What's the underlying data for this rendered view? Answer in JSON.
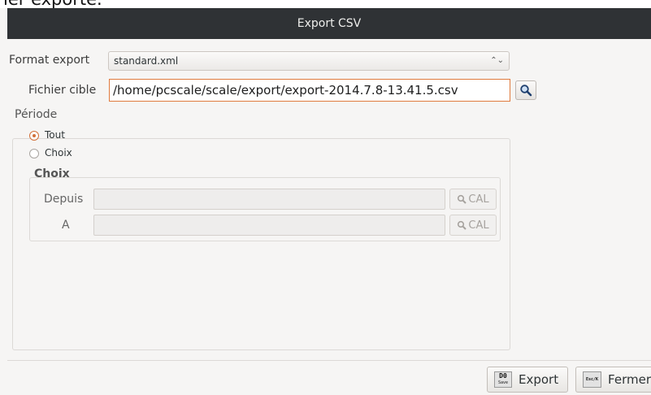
{
  "background_fragment": "ier exporté.",
  "window": {
    "title": "Export CSV"
  },
  "format": {
    "label": "Format export",
    "value": "standard.xml",
    "spin_glyph": "⌃⌄"
  },
  "target": {
    "label": "Fichier cible",
    "value": "/home/pcscale/scale/export/export-2014.7.8-13.41.5.csv"
  },
  "periode": {
    "title": "Période",
    "options": [
      {
        "label": "Tout",
        "checked": true
      },
      {
        "label": "Choix",
        "checked": false
      }
    ],
    "choix": {
      "title": "Choix",
      "from_label": "Depuis",
      "from_value": "",
      "to_label": "A",
      "to_value": "",
      "cal_label": "CAL"
    }
  },
  "buttons": {
    "export": {
      "label": "Export",
      "key": "D0",
      "key_sub": "Save"
    },
    "close": {
      "label": "Fermer",
      "key": "Esc/K"
    }
  },
  "colors": {
    "accent": "#d2703a",
    "titlebar": "#2f3235",
    "focus_border": "#e07a3e"
  }
}
